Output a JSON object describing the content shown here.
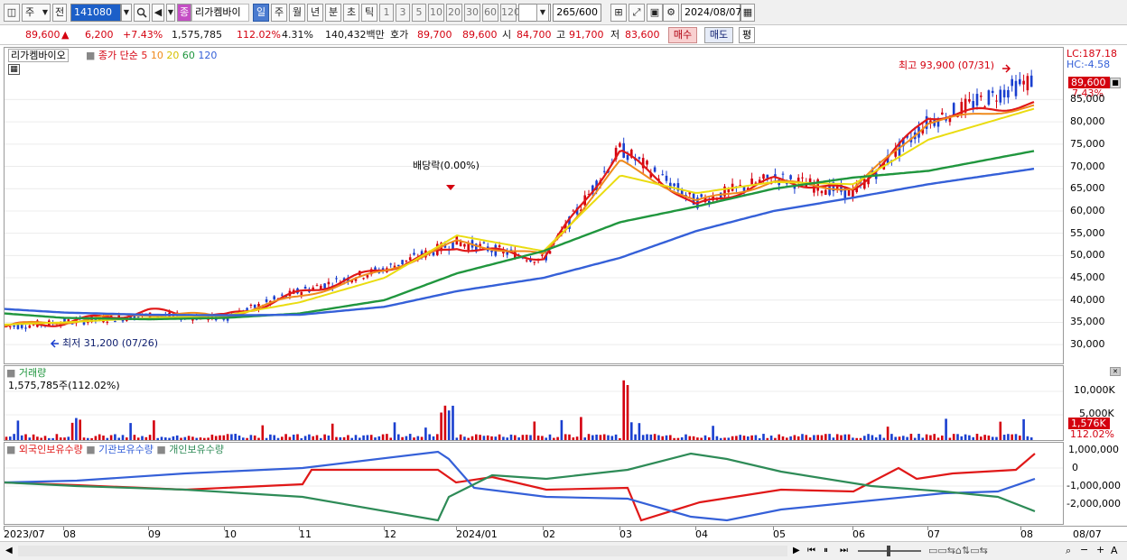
{
  "toolbar": {
    "type_select": "주",
    "prefix": "전",
    "code": "141080",
    "stock_name": "리가켐바이",
    "badge": "종",
    "periods": [
      "일",
      "주",
      "월",
      "년",
      "분",
      "초",
      "틱"
    ],
    "active_period": "일",
    "intervals": [
      "1",
      "3",
      "5",
      "10",
      "20",
      "30",
      "60",
      "120"
    ],
    "count": "265",
    "count_total": "/600",
    "date": "2024/08/07"
  },
  "quote": {
    "price": "89,600",
    "arrow": "▲",
    "change": "6,200",
    "change_pct": "+7.43%",
    "volume": "1,575,785",
    "volume_ratio": "112.02%",
    "turnover": "4.31%",
    "amount": "140,432백만",
    "ask_label": "호가",
    "ask": "89,700",
    "bid": "89,600",
    "open_label": "시",
    "open": "84,700",
    "high_label": "고",
    "high": "91,700",
    "low_label": "저",
    "low": "83,600",
    "buy": "매수",
    "sell": "매도",
    "avg": "평"
  },
  "legend": {
    "name": "리가켐바이오",
    "ma_prefix": "종가 단순",
    "ma": [
      {
        "period": "5",
        "color": "#e01818"
      },
      {
        "period": "10",
        "color": "#ef8a1c"
      },
      {
        "period": "20",
        "color": "#eadc10"
      },
      {
        "period": "60",
        "color": "#20963e"
      },
      {
        "period": "120",
        "color": "#3560d8"
      }
    ]
  },
  "price_axis": {
    "lc": "LC:187.18",
    "hc": "HC:-4.58",
    "current": "89,600",
    "current_pct": "7.43%",
    "ticks": [
      "85,000",
      "80,000",
      "75,000",
      "70,000",
      "65,000",
      "60,000",
      "55,000",
      "50,000",
      "45,000",
      "40,000",
      "35,000",
      "30,000"
    ]
  },
  "annotations": {
    "high": "최고 93,900 (07/31)",
    "low": "최저 31,200 (07/26)",
    "dividend": "배당락(0.00%)"
  },
  "volume": {
    "title": "거래량",
    "info": "1,575,785주(112.02%)",
    "ticks": [
      "10,000K",
      "5,000K"
    ],
    "current": "1,576K",
    "current_pct": "112.02%"
  },
  "holdings": {
    "series": [
      {
        "name": "외국인보유수량",
        "color": "#e01818"
      },
      {
        "name": "기관보유수량",
        "color": "#3560d8"
      },
      {
        "name": "개인보유수량",
        "color": "#2e8b57"
      }
    ],
    "ticks": [
      "1,000,000",
      "0",
      "-1,000,000",
      "-2,000,000"
    ]
  },
  "xaxis": {
    "labels": [
      "2023/07",
      "08",
      "09",
      "10",
      "11",
      "12",
      "2024/01",
      "02",
      "03",
      "04",
      "05",
      "06",
      "07",
      "08"
    ],
    "right": "08/07"
  },
  "colors": {
    "up": "#d4000f",
    "down": "#1a3fcf",
    "ma5": "#e01818",
    "ma10": "#ef8a1c",
    "ma20": "#eadc10",
    "ma60": "#20963e",
    "ma120": "#3560d8"
  },
  "chart_data": {
    "type": "line",
    "title": "리가켐바이오",
    "x": [
      "2023/07",
      "08",
      "09",
      "10",
      "11",
      "12",
      "2024/01",
      "02",
      "03",
      "04",
      "05",
      "06",
      "07",
      "08/07"
    ],
    "series": [
      {
        "name": "종가",
        "values": [
          34000,
          35000,
          36500,
          36000,
          42000,
          47000,
          53000,
          49000,
          74000,
          62000,
          67500,
          64000,
          80000,
          89600
        ]
      },
      {
        "name": "5",
        "values": [
          34000,
          35000,
          37500,
          36200,
          41500,
          47000,
          52000,
          49500,
          73500,
          61000,
          67000,
          64500,
          81000,
          84000
        ]
      },
      {
        "name": "10",
        "values": [
          34200,
          35200,
          37000,
          36400,
          40800,
          46500,
          53000,
          50000,
          71000,
          62000,
          66500,
          65000,
          80000,
          83500
        ]
      },
      {
        "name": "20",
        "values": [
          34500,
          35000,
          36000,
          36500,
          39500,
          45000,
          54500,
          51000,
          68000,
          64000,
          66500,
          66000,
          76000,
          83000
        ]
      },
      {
        "name": "60",
        "values": [
          37000,
          36000,
          35700,
          36000,
          37000,
          40000,
          46000,
          51000,
          57500,
          61000,
          65000,
          67500,
          69000,
          73500
        ]
      },
      {
        "name": "120",
        "values": [
          38000,
          37200,
          36700,
          36600,
          36700,
          38500,
          42000,
          45000,
          49500,
          55500,
          60000,
          63000,
          66000,
          69500
        ]
      }
    ],
    "ylim": [
      27000,
      95000
    ],
    "annotations": [
      "최고 93,900 (07/31)",
      "최저 31,200 (07/26)",
      "배당락(0.00%)"
    ]
  }
}
